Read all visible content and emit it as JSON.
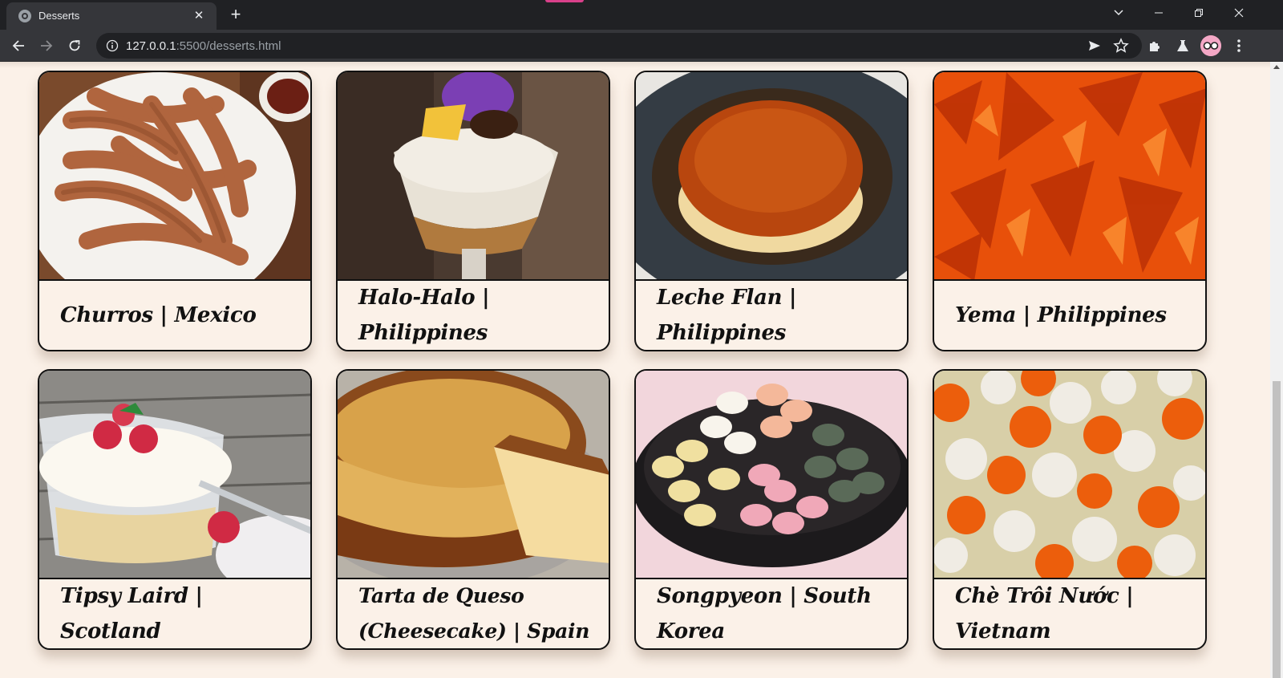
{
  "browser": {
    "tab_title": "Desserts",
    "url_host": "127.0.0.1",
    "url_path": ":5500/desserts.html"
  },
  "desserts": [
    {
      "caption": "Churros | Mexico",
      "image": "churros"
    },
    {
      "caption": "Halo-Halo | Philippines",
      "image": "halo-halo"
    },
    {
      "caption": "Leche Flan | Philippines",
      "image": "leche-flan"
    },
    {
      "caption": "Yema | Philippines",
      "image": "yema"
    },
    {
      "caption": "Tipsy Laird | Scotland",
      "image": "tipsy-laird"
    },
    {
      "caption": "Tarta de Queso (Cheesecake) | Spain",
      "image": "tarta-de-queso"
    },
    {
      "caption": "Songpyeon | South Korea",
      "image": "songpyeon"
    },
    {
      "caption": "Chè Trôi Nước | Vietnam",
      "image": "che-troi-nuoc"
    }
  ],
  "colors": {
    "page_background": "#fbf1e8",
    "card_border": "#111111",
    "browser_frame": "#202124",
    "toolbar": "#35363a"
  }
}
